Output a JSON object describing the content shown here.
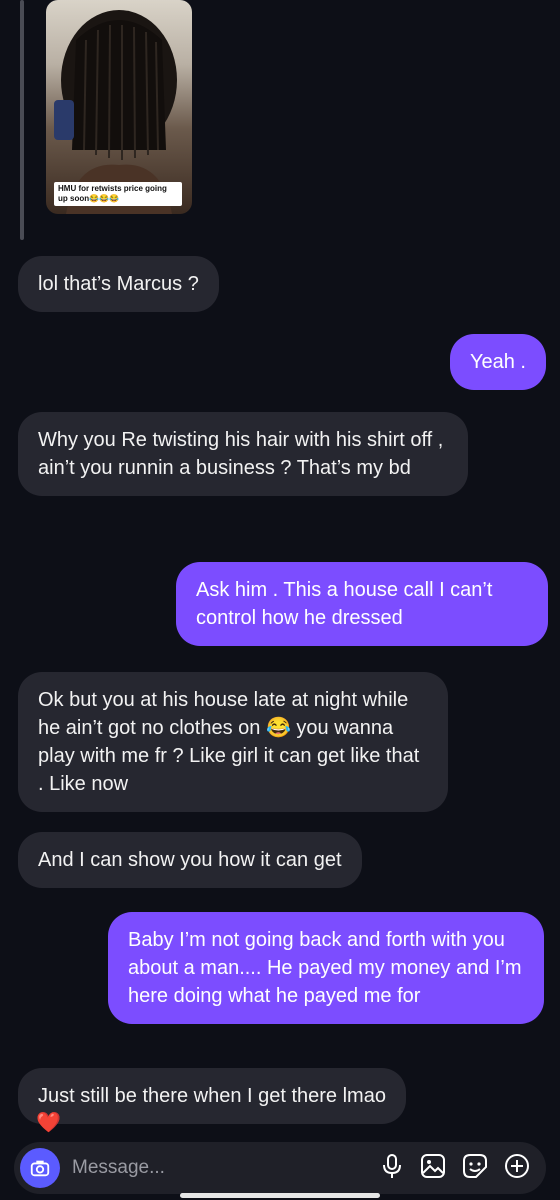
{
  "story": {
    "caption": "HMU for retwists price going up soon😂😂😂"
  },
  "messages": [
    {
      "dir": "in",
      "text": "lol that’s Marcus ?"
    },
    {
      "dir": "out",
      "text": "Yeah ."
    },
    {
      "dir": "in",
      "text": "Why you Re twisting his hair with his shirt off , ain’t you runnin a business ? That’s my bd"
    },
    {
      "dir": "out",
      "text": "Ask him . This a house call I can’t control how he dressed"
    },
    {
      "dir": "in",
      "text": "Ok but you at his house late at night while he ain’t got no clothes on 😂 you wanna play with me fr ? Like girl it can get like that . Like now"
    },
    {
      "dir": "in",
      "text": "And I can show you how it can get"
    },
    {
      "dir": "out",
      "text": "Baby I’m not going back and forth with you about a man.... He payed my money and I’m here doing what he payed me for"
    },
    {
      "dir": "in",
      "text": "Just still be there when I get there lmao"
    }
  ],
  "reaction": "❤️",
  "composer": {
    "placeholder": "Message..."
  },
  "icons": [
    "camera-icon",
    "microphone-icon",
    "gallery-icon",
    "sticker-icon",
    "add-icon"
  ],
  "colors": {
    "background": "#0d0f17",
    "incoming": "#262730",
    "outgoing": "#7c4dff",
    "camera": "#5b5bff"
  }
}
